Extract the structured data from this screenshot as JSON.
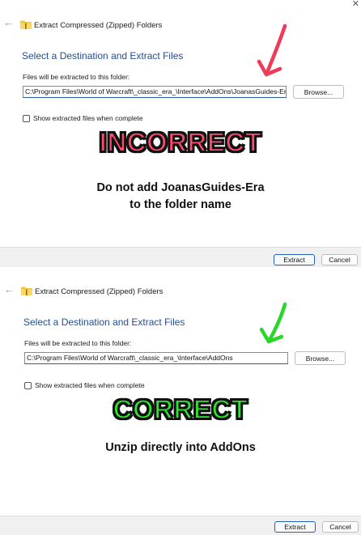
{
  "incorrect_example": {
    "window_title": "Extract Compressed (Zipped) Folders",
    "heading": "Select a Destination and Extract Files",
    "field_label": "Files will be extracted to this folder:",
    "path_value": "C:\\Program Files\\World of Warcraft\\_classic_era_\\Interface\\AddOns\\JoanasGuides-Era",
    "browse_label": "Browse...",
    "checkbox_label": "Show extracted files when complete",
    "verdict": "INCORRECT",
    "note_line1": "Do not add JoanasGuides-Era",
    "note_line2": "to the folder name",
    "extract_label": "Extract",
    "cancel_label": "Cancel",
    "verdict_color": "#ff4b6e",
    "arrow_color": "#f03a5a"
  },
  "correct_example": {
    "window_title": "Extract Compressed (Zipped) Folders",
    "heading": "Select a Destination and Extract Files",
    "field_label": "Files will be extracted to this folder:",
    "path_value": "C:\\Program Files\\World of Warcraft\\_classic_era_\\Interface\\AddOns",
    "browse_label": "Browse...",
    "checkbox_label": "Show extracted files when complete",
    "verdict": "CORRECT",
    "note": "Unzip directly into AddOns",
    "extract_label": "Extract",
    "cancel_label": "Cancel",
    "verdict_color": "#2ee82e",
    "arrow_color": "#2bd62b"
  },
  "icons": {
    "close": "close-icon",
    "back": "back-arrow-icon",
    "folder": "zipped-folder-icon"
  }
}
